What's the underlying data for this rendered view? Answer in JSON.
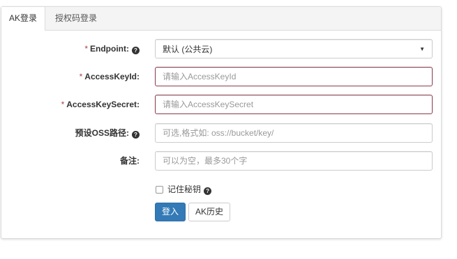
{
  "tabs": [
    {
      "label": "AK登录"
    },
    {
      "label": "授权码登录"
    }
  ],
  "form": {
    "endpoint": {
      "required": "*",
      "label": "Endpoint:",
      "value": "默认 (公共云)"
    },
    "access_key_id": {
      "required": "*",
      "label": "AccessKeyId:",
      "placeholder": "请输入AccessKeyId"
    },
    "access_key_secret": {
      "required": "*",
      "label": "AccessKeySecret:",
      "placeholder": "请输入AccessKeySecret"
    },
    "oss_path": {
      "label": "预设OSS路径:",
      "placeholder": "可选,格式如: oss://bucket/key/"
    },
    "note": {
      "label": "备注:",
      "placeholder": "可以为空，最多30个字"
    },
    "remember": {
      "label": "记住秘钥",
      "checked": false
    }
  },
  "buttons": {
    "login": "登入",
    "history": "AK历史"
  },
  "icons": {
    "help": "question-circle-icon",
    "caret": "caret-down-icon"
  },
  "colors": {
    "primary": "#337ab7",
    "error_border": "#8b3a4a",
    "required": "#a94442"
  }
}
